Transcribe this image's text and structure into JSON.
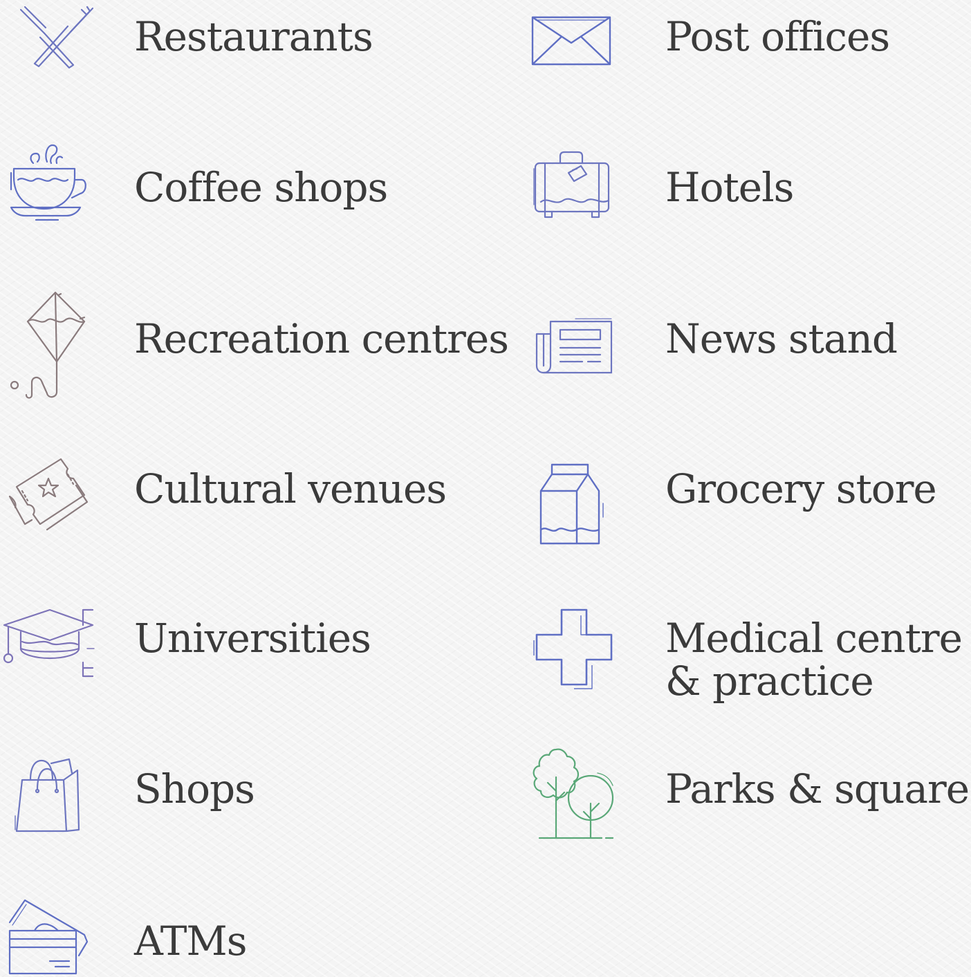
{
  "colors": {
    "text": "#3b3b3b",
    "icon_blue": "#5f6fc4",
    "icon_purple": "#7d74b8",
    "icon_taupe": "#8a7b7d",
    "icon_green": "#5aa878"
  },
  "amenities": [
    {
      "label": "Restaurants",
      "icon": "fork-knife-icon"
    },
    {
      "label": "Post offices",
      "icon": "envelope-icon"
    },
    {
      "label": "Coffee shops",
      "icon": "coffee-cup-icon"
    },
    {
      "label": "Hotels",
      "icon": "suitcase-icon"
    },
    {
      "label": "Recreation centres",
      "icon": "kite-icon"
    },
    {
      "label": "News stand",
      "icon": "newspaper-icon"
    },
    {
      "label": "Cultural venues",
      "icon": "ticket-icon"
    },
    {
      "label": "Grocery store",
      "icon": "milk-carton-icon"
    },
    {
      "label": "Universities",
      "icon": "graduation-cap-icon"
    },
    {
      "label": "Medical centre\n& practice",
      "icon": "medical-cross-icon"
    },
    {
      "label": "Shops",
      "icon": "shopping-bag-icon"
    },
    {
      "label": "Parks & squares",
      "icon": "trees-icon"
    },
    {
      "label": "ATMs",
      "icon": "credit-card-icon"
    }
  ]
}
